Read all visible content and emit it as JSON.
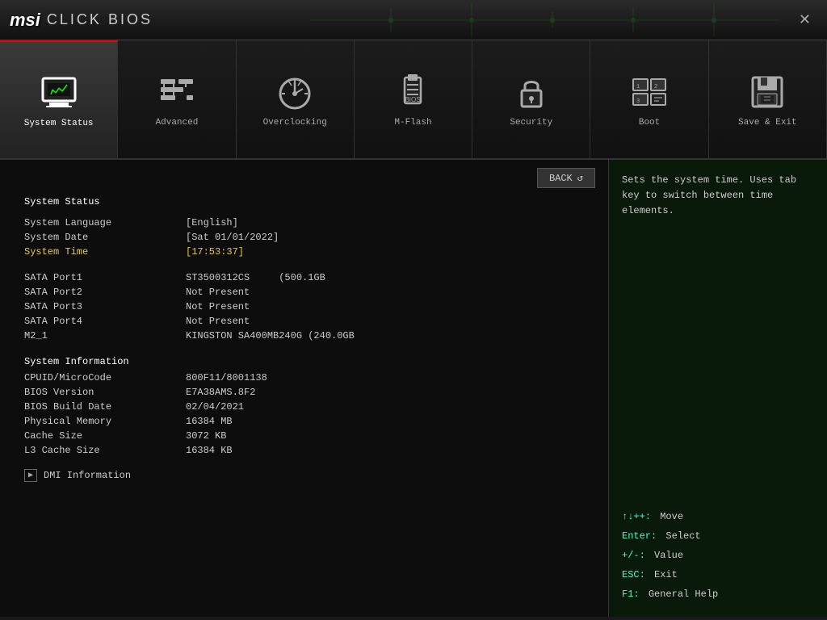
{
  "titlebar": {
    "logo": "msi",
    "product": "CLICK BIOS",
    "close_label": "✕"
  },
  "nav": {
    "tabs": [
      {
        "id": "system-status",
        "label": "System Status",
        "icon": "monitor",
        "active": true
      },
      {
        "id": "advanced",
        "label": "Advanced",
        "icon": "settings",
        "active": false
      },
      {
        "id": "overclocking",
        "label": "Overclocking",
        "icon": "clock",
        "active": false
      },
      {
        "id": "m-flash",
        "label": "M-Flash",
        "icon": "usb",
        "active": false
      },
      {
        "id": "security",
        "label": "Security",
        "icon": "lock",
        "active": false
      },
      {
        "id": "boot",
        "label": "Boot",
        "icon": "boot",
        "active": false
      },
      {
        "id": "save-exit",
        "label": "Save & Exit",
        "icon": "save",
        "active": false
      }
    ]
  },
  "back_button": "BACK",
  "content": {
    "section_title": "System Status",
    "rows": [
      {
        "label": "System Language",
        "value": "[English]",
        "highlight": false
      },
      {
        "label": "System Date",
        "value": "[Sat 01/01/2022]",
        "highlight": false
      },
      {
        "label": "System Time",
        "value": "[17:53:37]",
        "highlight": true
      }
    ],
    "sata_ports": [
      {
        "label": "SATA Port1",
        "value": "ST3500312CS",
        "extra": "(500.1GB"
      },
      {
        "label": "SATA Port2",
        "value": "Not Present",
        "extra": ""
      },
      {
        "label": "SATA Port3",
        "value": "Not Present",
        "extra": ""
      },
      {
        "label": "SATA Port4",
        "value": "Not Present",
        "extra": ""
      },
      {
        "label": "M2_1",
        "value": "KINGSTON SA400MB240G (240.0GB",
        "extra": ""
      }
    ],
    "system_info_title": "System Information",
    "system_info": [
      {
        "label": "CPUID/MicroCode",
        "value": "800F11/8001138"
      },
      {
        "label": "BIOS Version",
        "value": "E7A38AMS.8F2"
      },
      {
        "label": "BIOS Build Date",
        "value": "02/04/2021"
      },
      {
        "label": "Physical Memory",
        "value": "16384 MB"
      },
      {
        "label": "Cache Size",
        "value": "3072 KB"
      },
      {
        "label": "L3 Cache Size",
        "value": "16384 KB"
      }
    ],
    "dmi_label": "DMI Information"
  },
  "right_panel": {
    "help_text": "Sets the system time. Uses tab key to switch between time elements.",
    "key_hints": [
      {
        "key": "↑↓++:",
        "action": "Move"
      },
      {
        "key": "Enter:",
        "action": "Select"
      },
      {
        "key": "+/-:",
        "action": "Value"
      },
      {
        "key": "ESC:",
        "action": "Exit"
      },
      {
        "key": "F1:",
        "action": "General Help"
      }
    ]
  }
}
